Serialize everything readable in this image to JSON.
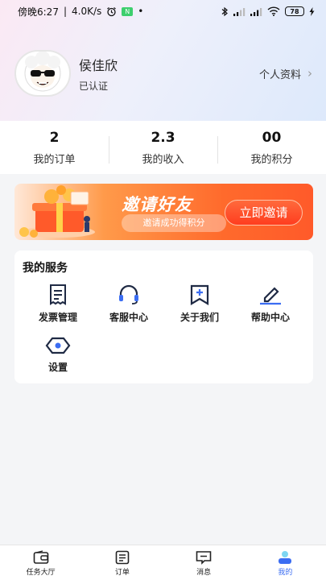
{
  "status_bar": {
    "time": "傍晚6:27",
    "network_speed": "4.0K/s",
    "app_badge": "N",
    "dot": "•",
    "battery": "78"
  },
  "profile": {
    "username": "侯佳欣",
    "status": "已认证",
    "profile_link": "个人资料",
    "chevron": "›"
  },
  "stats": [
    {
      "value": "2",
      "label": "我的订单"
    },
    {
      "value": "2.3",
      "label": "我的收入"
    },
    {
      "value": "00",
      "label": "我的积分"
    }
  ],
  "banner": {
    "title": "邀请好友",
    "subtitle": "邀请成功得积分",
    "button": "立即邀请"
  },
  "services": {
    "title": "我的服务",
    "items": [
      {
        "label": "发票管理",
        "icon": "invoice-icon"
      },
      {
        "label": "客服中心",
        "icon": "headset-icon"
      },
      {
        "label": "关于我们",
        "icon": "bookmark-plus-icon"
      },
      {
        "label": "帮助中心",
        "icon": "pencil-icon"
      },
      {
        "label": "设置",
        "icon": "eye-hexagon-icon"
      }
    ]
  },
  "tabbar": {
    "items": [
      {
        "label": "任务大厅",
        "icon": "wallet-icon",
        "active": false
      },
      {
        "label": "订单",
        "icon": "list-icon",
        "active": false
      },
      {
        "label": "消息",
        "icon": "message-icon",
        "active": false
      },
      {
        "label": "我的",
        "icon": "person-icon",
        "active": true
      }
    ]
  },
  "colors": {
    "accent": "#3b6df2",
    "banner_orange": "#ff5a2a",
    "icon_dark": "#1f2a44"
  }
}
